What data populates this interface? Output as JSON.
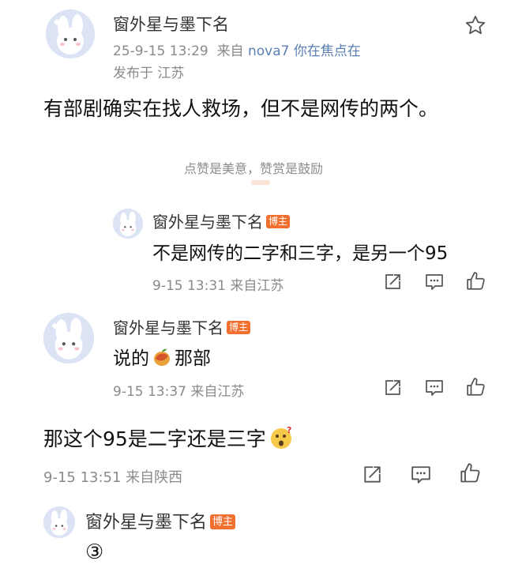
{
  "post": {
    "author": "窗外星与墨下名",
    "time": "25-9-15 13:29",
    "source_prefix": "来自",
    "source_device": "nova7 你在焦点在",
    "location": "发布于 江苏",
    "text": "有部剧确实在找人救场，但不是网传的两个。"
  },
  "appreciation_note": "点赞是美意，赞赏是鼓励",
  "replies": [
    {
      "author": "窗外星与墨下名",
      "badge": "博主",
      "text": "不是网传的二字和三字，是另一个95",
      "meta": "9-15 13:31 来自江苏"
    },
    {
      "author": "窗外星与墨下名",
      "badge": "博主",
      "text_before": "说的",
      "emoji": "mango-emoji",
      "text_after": "那部",
      "meta": "9-15 13:37 来自江苏"
    },
    {
      "text": "那这个95是二字还是三字",
      "emoji": "thinking-face-emoji",
      "meta": "9-15 13:51 来自陕西"
    },
    {
      "author": "窗外星与墨下名",
      "badge": "博主",
      "text": "③"
    }
  ],
  "icons": {
    "favorite": "star-icon",
    "repost": "repost-icon",
    "comment": "comment-icon",
    "like": "thumbs-up-icon"
  },
  "colors": {
    "badge": "#f2702f",
    "link": "#5b7fb3",
    "meta": "#8a8a8a"
  }
}
